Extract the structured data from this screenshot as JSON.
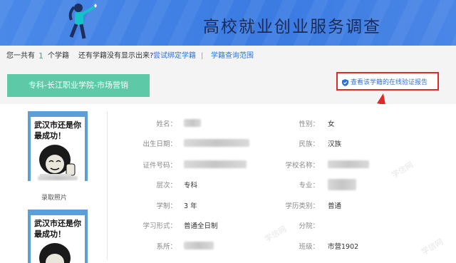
{
  "banner": {
    "title": "高校就业创业服务调查"
  },
  "subbar": {
    "prefix": "您一共有",
    "count": "1",
    "suffix": "个学籍",
    "question": "还有学籍没有显示出来?",
    "bind_link": "尝试绑定学籍",
    "separator": "|",
    "range_link": "学籍查询范围"
  },
  "tab": {
    "label": "专科-长江职业学院-市场营销"
  },
  "verify_button": {
    "label": "查看该学籍的在线验证报告"
  },
  "photo": {
    "meme_text": "武汉市还是你最成功！",
    "caption": "录取照片"
  },
  "fields": [
    {
      "label": "姓名：",
      "value": ""
    },
    {
      "label": "性别：",
      "value": "女"
    },
    {
      "label": "出生日期：",
      "value": ""
    },
    {
      "label": "民族：",
      "value": "汉族"
    },
    {
      "label": "证件号码：",
      "value": ""
    },
    {
      "label": "学校名称：",
      "value": ""
    },
    {
      "label": "层次：",
      "value": "专科"
    },
    {
      "label": "专业：",
      "value": ""
    },
    {
      "label": "学制：",
      "value": "3 年"
    },
    {
      "label": "学历类别：",
      "value": "普通"
    },
    {
      "label": "学习形式：",
      "value": "普通全日制"
    },
    {
      "label": "分院：",
      "value": ""
    },
    {
      "label": "系所：",
      "value": ""
    },
    {
      "label": "班级：",
      "value": "市营1902"
    }
  ],
  "watermark": "学信网",
  "colors": {
    "banner": "#3b7be2",
    "tab": "#5ec9a6",
    "link": "#2f72d6",
    "highlight": "#e02a2a"
  }
}
